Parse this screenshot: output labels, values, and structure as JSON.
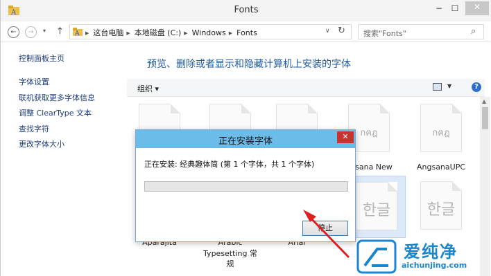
{
  "window": {
    "title": "Fonts",
    "minimize": "−",
    "maximize": "☐",
    "close": "✕"
  },
  "address": {
    "back": "←",
    "forward": "→",
    "recent": "▾",
    "up": "↑",
    "crumbs": [
      "这台电脑",
      "本地磁盘 (C:)",
      "Windows",
      "Fonts"
    ],
    "crumb_sep": "▶",
    "dropdown": "∨",
    "refresh": "↻",
    "search_placeholder": "搜索\"Fonts\"",
    "search_icon": "⌕"
  },
  "sidebar": {
    "home": "控制面板主页",
    "links": [
      "字体设置",
      "联机获取更多字体信息",
      "调整 ClearType 文本",
      "查找字符",
      "更改字体大小"
    ]
  },
  "main": {
    "heading": "预览、删除或者显示和隐藏计算机上安装的字体",
    "organize": "组织 ▾",
    "view_drop": "▼",
    "help": "?"
  },
  "tiles": [
    {
      "glyph": "",
      "label": ""
    },
    {
      "glyph": "",
      "label": ""
    },
    {
      "glyph": "",
      "label": ""
    },
    {
      "glyph": "กคฎ",
      "label": "ngsana New"
    },
    {
      "glyph": "กคฎ",
      "label": "AngsanaUPC"
    },
    {
      "glyph": "",
      "label": "Aparajita"
    },
    {
      "glyph": "",
      "label": "Arabic"
    },
    {
      "glyph": "",
      "label": "Arial"
    },
    {
      "glyph": "한글",
      "label": ""
    },
    {
      "glyph": "한글",
      "label": ""
    }
  ],
  "tile_extra": {
    "line2": "Typesetting 常",
    "line3": "规"
  },
  "dialog": {
    "title": "正在安装字体",
    "close": "✕",
    "message": "正在安装: 经典趣体简 (第 1 个字体，共 1 个字体)",
    "progress": 0.0,
    "stop": "停止"
  },
  "scroll": {
    "up": "▲"
  },
  "watermark": {
    "text": "爱纯净",
    "url": "aichunjing.com"
  },
  "colors": {
    "dialog_title": "#6cbcea",
    "arrow": "#e02020",
    "link": "#1e3c78",
    "heading": "#1e5a9c"
  }
}
